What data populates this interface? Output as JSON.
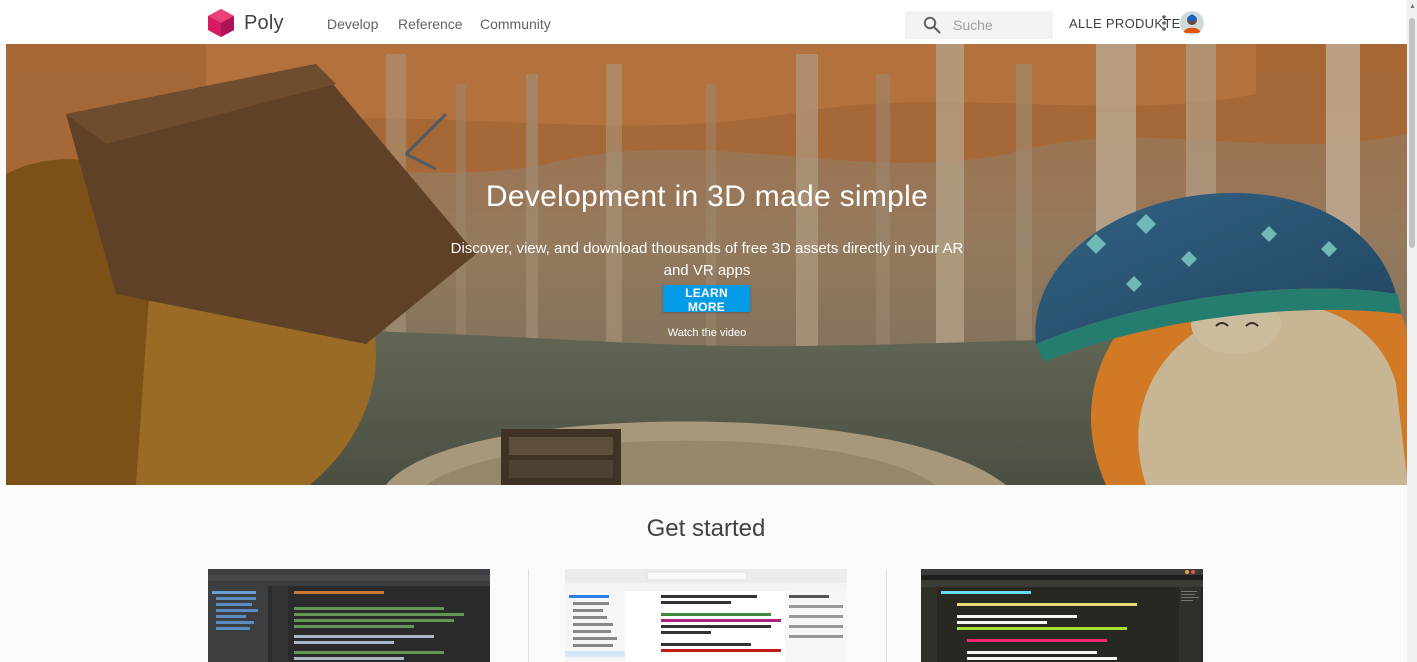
{
  "header": {
    "brand": "Poly",
    "nav": [
      "Develop",
      "Reference",
      "Community"
    ],
    "search_placeholder": "Suche",
    "products_label": "ALLE PRODUKTE"
  },
  "hero": {
    "title": "Development in 3D made simple",
    "subtitle": "Discover, view, and download thousands of free 3D assets directly in your AR and VR apps",
    "cta_label": "LEARN MORE",
    "video_link": "Watch the video"
  },
  "get_started": {
    "title": "Get started",
    "thumbnails": [
      "android-studio-screenshot",
      "xcode-screenshot",
      "sublime-text-screenshot"
    ]
  },
  "colors": {
    "accent": "#039be5",
    "logo": "#e91e63"
  },
  "icons": [
    "poly-logo-icon",
    "search-icon",
    "more-vert-icon",
    "avatar"
  ]
}
